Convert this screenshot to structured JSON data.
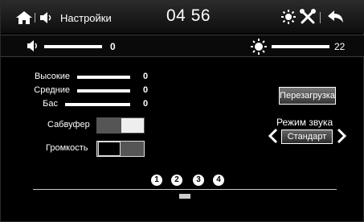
{
  "header": {
    "title": "Настройки",
    "clock": "04 56"
  },
  "sliders": {
    "volume": {
      "value": "0"
    },
    "brightness": {
      "value": "22"
    }
  },
  "eq": [
    {
      "label": "Высокие",
      "value": "0"
    },
    {
      "label": "Средние",
      "value": "0"
    },
    {
      "label": "Бас",
      "value": "0"
    }
  ],
  "subwoofer": {
    "label": "Сабвуфер",
    "on": true
  },
  "loudness": {
    "label": "Громкость",
    "on": false
  },
  "reset_button": {
    "label": "Перезагрузка"
  },
  "sound_mode": {
    "label": "Режим звука",
    "value": "Стандарт"
  },
  "pages": [
    "1",
    "2",
    "3",
    "4"
  ],
  "icons": {
    "home": "home-icon",
    "volume": "speaker-icon",
    "brightness": "sun-icon",
    "tools": "tools-icon",
    "back": "back-arrow-icon"
  },
  "colors": {
    "background": "#000000",
    "foreground": "#ffffff",
    "toggle_off": "#555555"
  }
}
